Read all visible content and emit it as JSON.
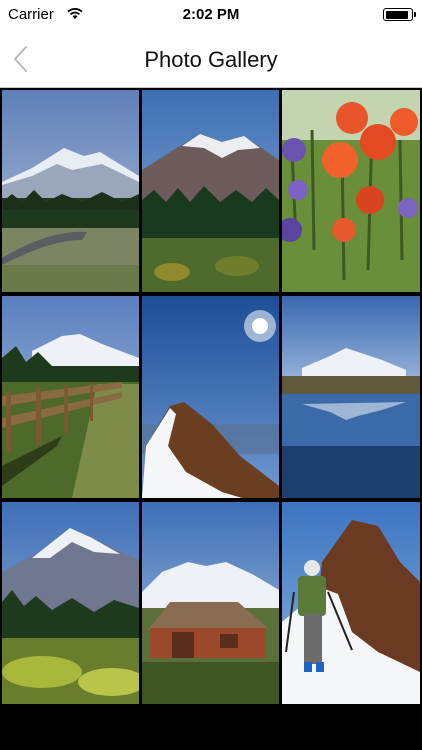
{
  "status_bar": {
    "carrier": "Carrier",
    "time": "2:02 PM",
    "battery_level": 0.95
  },
  "nav": {
    "title": "Photo Gallery",
    "back_icon": "chevron-left-icon"
  },
  "gallery": {
    "photos": [
      {
        "subject": "mountain-road"
      },
      {
        "subject": "mountain-forest"
      },
      {
        "subject": "wildflowers"
      },
      {
        "subject": "mountain-fence-path"
      },
      {
        "subject": "snow-ridge-sun"
      },
      {
        "subject": "mountain-lake-reflection"
      },
      {
        "subject": "mountain-meadow"
      },
      {
        "subject": "mountain-barn"
      },
      {
        "subject": "hiker-snow-ridge"
      }
    ]
  }
}
